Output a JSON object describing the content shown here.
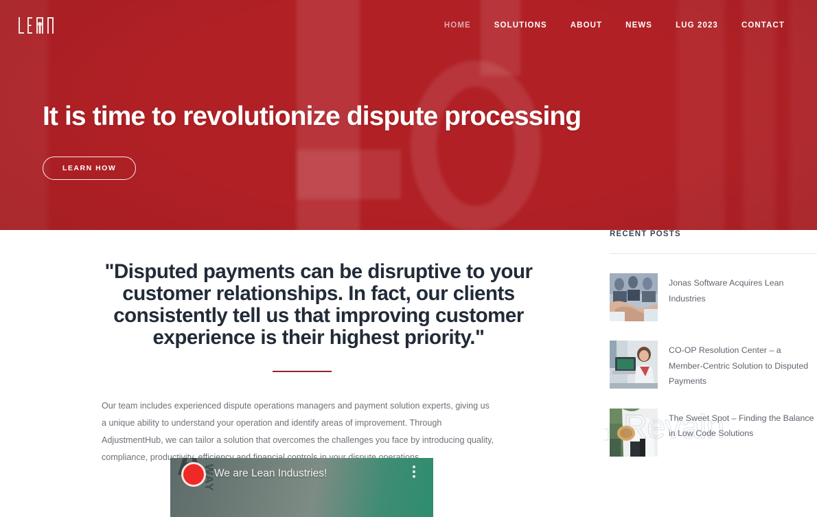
{
  "brand": {
    "logo_text": "LEAN"
  },
  "nav": {
    "items": [
      {
        "label": "HOME",
        "active": true
      },
      {
        "label": "SOLUTIONS",
        "active": false
      },
      {
        "label": "ABOUT",
        "active": false
      },
      {
        "label": "NEWS",
        "active": false
      },
      {
        "label": "LUG 2023",
        "active": false
      },
      {
        "label": "CONTACT",
        "active": false
      }
    ]
  },
  "hero": {
    "title": "It is time to revolutionize dispute processing",
    "cta_label": "LEARN HOW",
    "background_color": "#b02025"
  },
  "main": {
    "quote": "\"Disputed payments can be disruptive to your customer relationships. In fact, our clients consistently tell us that improving customer experience is their highest priority.\"",
    "body": "Our team includes experienced dispute operations managers and payment solution experts, giving us a unique ability to understand your operation and identify areas of improvement. Through AdjustmentHub, we can tailor a solution that overcomes the challenges you face by introducing quality, compliance, productivity, efficiency and financial controls in your dispute operations.",
    "divider_color": "#8e2230"
  },
  "video": {
    "title": "We are Lean Industries!",
    "ghost_text": "A",
    "ghost_text_2": "THE WAY",
    "avatar_color": "#ef2a26"
  },
  "sidebar": {
    "title": "RECENT POSTS",
    "posts": [
      {
        "title": "Jonas Software Acquires Lean Industries",
        "thumb": "handshake-photo"
      },
      {
        "title": "CO-OP Resolution Center – a Member-Centric Solution to Disputed Payments",
        "thumb": "woman-at-desk-photo"
      },
      {
        "title": "The Sweet Spot – Finding the Balance in Low Code Solutions",
        "thumb": "baseball-photo"
      }
    ]
  },
  "watermark": {
    "text": "Revain"
  }
}
